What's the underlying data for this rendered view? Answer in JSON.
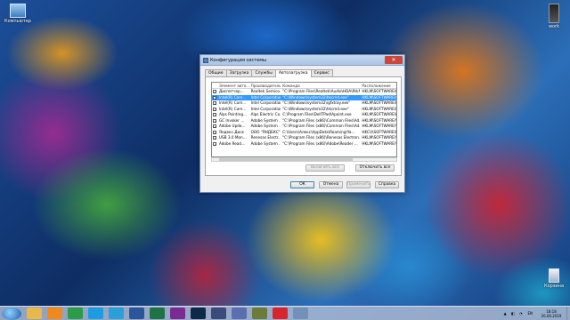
{
  "desktop": {
    "icons": [
      {
        "label": "Компьютер"
      },
      {
        "label": "work"
      },
      {
        "label": "Корзина"
      }
    ]
  },
  "dialog": {
    "title": "Конфигурация системы",
    "close_glyph": "✕",
    "tabs": [
      "Общие",
      "Загрузка",
      "Службы",
      "Автозагрузка",
      "Сервис"
    ],
    "active_tab": "Автозагрузка",
    "columns": [
      "Элемент авто...",
      "Производитель",
      "Команда",
      "Расположение"
    ],
    "rows": [
      {
        "checked": true,
        "item": "Диспетчер...",
        "maker": "Realtek Semico...",
        "command": "\"C:\\Program Files\\Realtek\\Audio\\HDA\\RtkN...",
        "location": "HKLM\\SOFTWARE\\M..."
      },
      {
        "checked": true,
        "item": "Intel(R) Com...",
        "maker": "Intel Corporation",
        "command": "\"C:\\Windows\\system32\\hkcmd.exe\"",
        "location": "HKLM\\SOFTWARE\\M...",
        "selected": true
      },
      {
        "checked": true,
        "item": "Intel(R) Com...",
        "maker": "Intel Corporation",
        "command": "\"C:\\Windows\\system32\\igfxtray.exe\"",
        "location": "HKLM\\SOFTWARE\\M..."
      },
      {
        "checked": true,
        "item": "Intel(R) Com...",
        "maker": "Intel Corporation",
        "command": "\"C:\\Windows\\system32\\hkcmd.exe\"",
        "location": "HKLM\\SOFTWARE\\M..."
      },
      {
        "checked": true,
        "item": "Alps Pointing...",
        "maker": "Alps Electric Co...",
        "command": "C:\\Program Files\\DellTPad\\Apoint.exe",
        "location": "HKLM\\SOFTWARE\\M..."
      },
      {
        "checked": true,
        "item": "GC Invoker ...",
        "maker": "Adobe System ...",
        "command": "\"C:\\Program Files (x86)\\Common Files\\Ad...",
        "location": "HKLM\\SOFTWARE\\W..."
      },
      {
        "checked": true,
        "item": "Adobe Upda...",
        "maker": "Adobe System ...",
        "command": "\"C:\\Program Files (x86)\\Common Files\\Ad...",
        "location": "HKLM\\SOFTWARE\\W..."
      },
      {
        "checked": true,
        "item": "Яндекс.Диск",
        "maker": "ООО \"ЯНДЕКС\"",
        "command": "C:\\Users\\Алекс\\AppData\\Roaming\\Ya...",
        "location": "HKCU\\SOFTWARE\\M..."
      },
      {
        "checked": true,
        "item": "USB 3.0 Mon...",
        "maker": "Renesas Electr...",
        "command": "\"C:\\Program Files (x86)\\Renesas Electron...",
        "location": "HKLM\\SOFTWARE\\W..."
      },
      {
        "checked": true,
        "item": "Adobe Read...",
        "maker": "Adobe System ...",
        "command": "\"C:\\Program Files (x86)\\Adobe\\Reader ...",
        "location": "HKLM\\SOFTWARE\\W..."
      }
    ],
    "enable_all": "Включить все",
    "disable_all": "Отключить все",
    "ok": "ОК",
    "cancel": "Отмена",
    "apply": "Применить",
    "help": "Справка"
  },
  "taskbar": {
    "apps": [
      {
        "name": "explorer-icon",
        "color": "#e8b84a"
      },
      {
        "name": "media-player-icon",
        "color": "#f08a1c"
      },
      {
        "name": "chrome-icon",
        "color": "#2d9b4a"
      },
      {
        "name": "skype-icon",
        "color": "#1f9be1"
      },
      {
        "name": "telegram-icon",
        "color": "#2a9fd8"
      },
      {
        "name": "word-icon",
        "color": "#2b579a"
      },
      {
        "name": "excel-icon",
        "color": "#217346"
      },
      {
        "name": "premiere-icon",
        "color": "#7a2b8f"
      },
      {
        "name": "photoshop-icon",
        "color": "#0b2a4a"
      },
      {
        "name": "app-icon",
        "color": "#3a4a7a"
      },
      {
        "name": "virtualbox-icon",
        "color": "#5b6fb0"
      },
      {
        "name": "game-icon",
        "color": "#6a7b3a"
      },
      {
        "name": "record-icon",
        "color": "#d8242c"
      },
      {
        "name": "msconfig-icon",
        "color": "#7390b8"
      }
    ],
    "lang": "EN",
    "time": "18:18",
    "date": "26.06.2019"
  }
}
